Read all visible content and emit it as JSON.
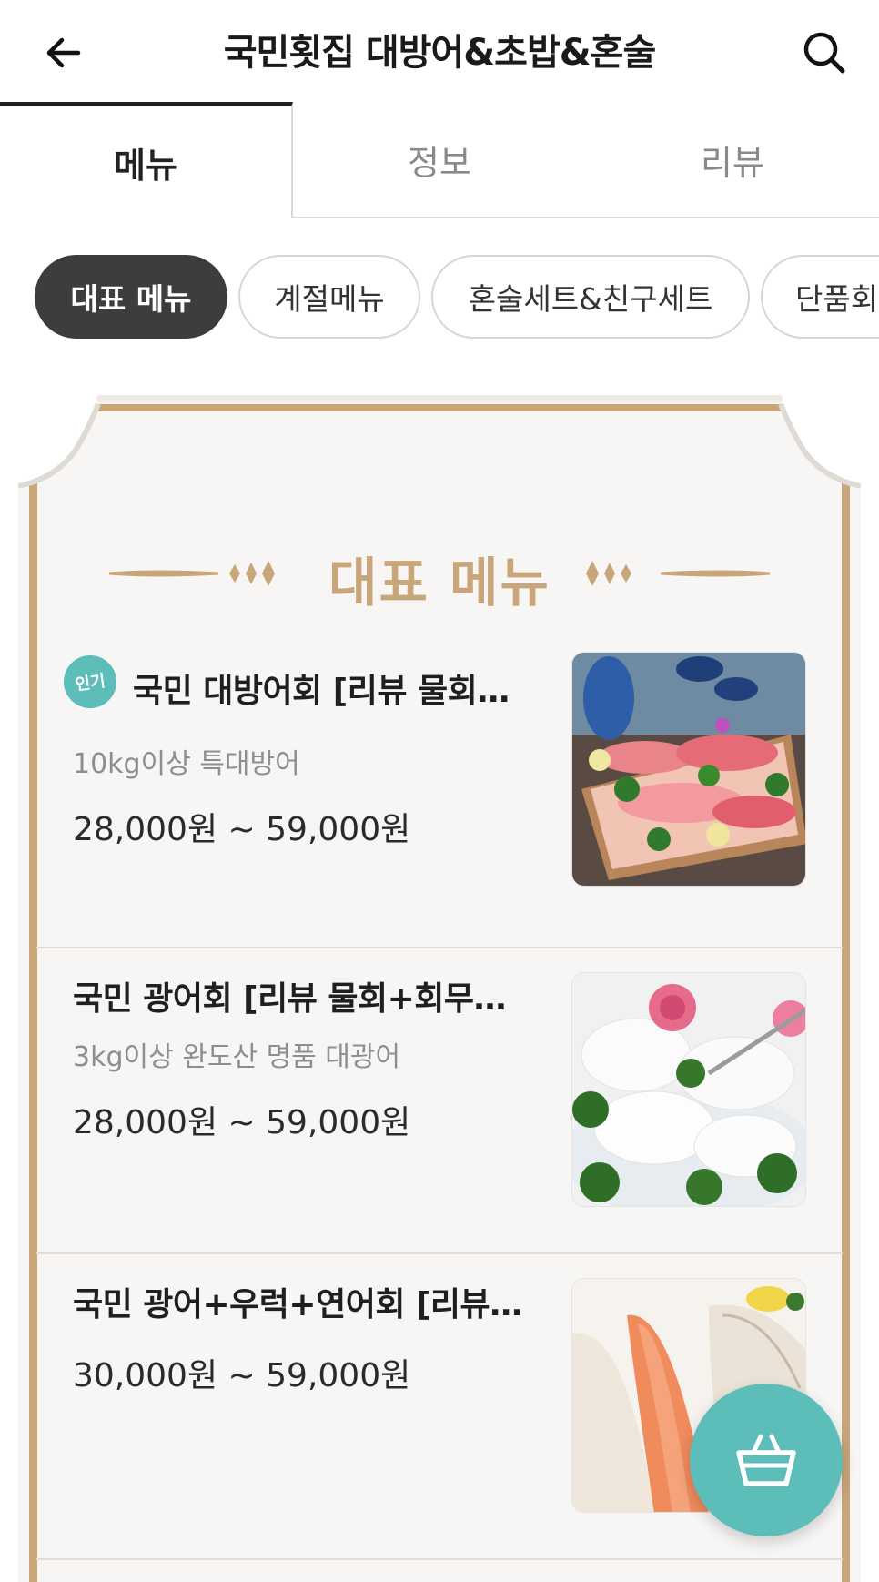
{
  "header": {
    "title": "국민횟집 대방어&초밥&혼술",
    "back_icon": "arrow-left-icon",
    "search_icon": "search-icon"
  },
  "tabs": [
    {
      "label": "메뉴",
      "active": true
    },
    {
      "label": "정보",
      "active": false
    },
    {
      "label": "리뷰",
      "active": false
    }
  ],
  "categories": [
    {
      "label": "대표 메뉴",
      "active": true
    },
    {
      "label": "계절메뉴",
      "active": false
    },
    {
      "label": "혼술세트&친구세트",
      "active": false
    },
    {
      "label": "단품회",
      "active": false
    }
  ],
  "section": {
    "title": "대표 메뉴"
  },
  "menu_items": [
    {
      "badge": "인기",
      "name": "국민 대방어회 [리뷰 물회…",
      "description": "10kg이상 특대방어",
      "price": "28,000원 ~ 59,000원"
    },
    {
      "name": "국민 광어회 [리뷰 물회+회무…",
      "description": "3kg이상 완도산 명품 대광어",
      "price": "28,000원 ~ 59,000원"
    },
    {
      "name": "국민 광어+우럭+연어회 [리뷰…",
      "price": "30,000원 ~ 59,000원"
    }
  ],
  "colors": {
    "accent_teal": "#5cbdb9",
    "gold": "#c8a679",
    "chip_active": "#3d3d3d"
  },
  "cart": {
    "icon": "shopping-basket-icon"
  }
}
